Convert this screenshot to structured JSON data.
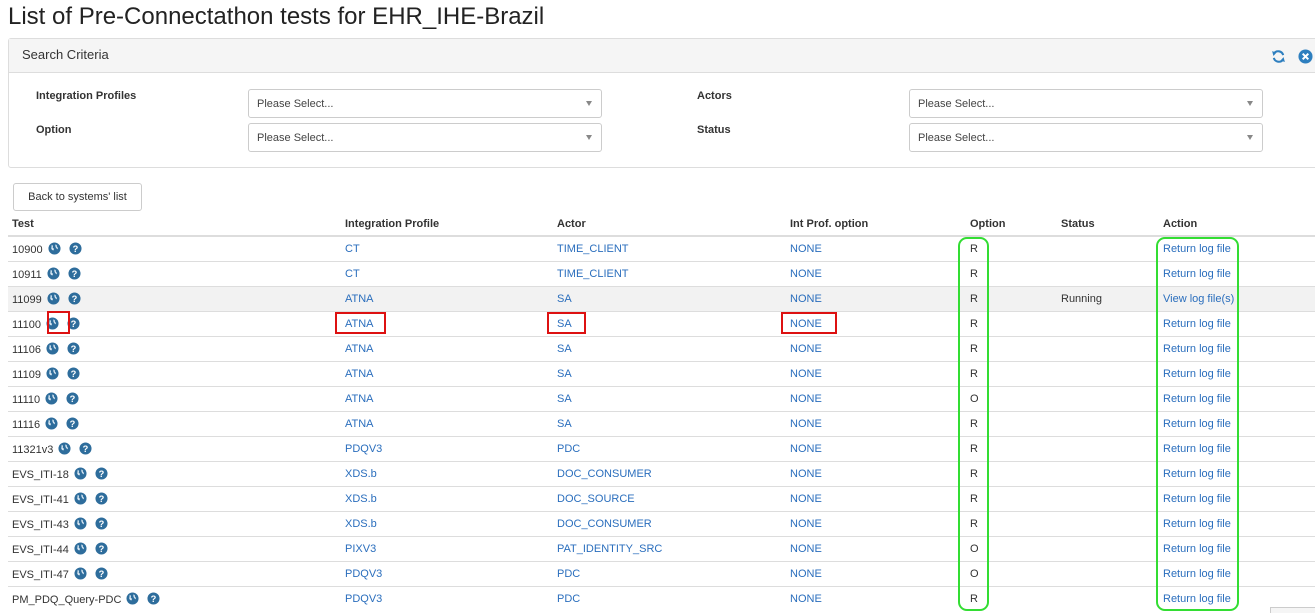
{
  "page": {
    "title": "List of Pre-Connectathon tests for EHR_IHE-Brazil"
  },
  "search": {
    "title": "Search Criteria",
    "integration_profiles": {
      "label": "Integration Profiles",
      "placeholder": "Please Select..."
    },
    "actors": {
      "label": "Actors",
      "placeholder": "Please Select..."
    },
    "option": {
      "label": "Option",
      "placeholder": "Please Select..."
    },
    "status": {
      "label": "Status",
      "placeholder": "Please Select..."
    }
  },
  "back_button": "Back to systems' list",
  "table": {
    "headers": {
      "test": "Test",
      "integration_profile": "Integration Profile",
      "actor": "Actor",
      "int_prof_option": "Int Prof. option",
      "option": "Option",
      "status": "Status",
      "action": "Action"
    },
    "rows": [
      {
        "test": "10900",
        "profile": "CT",
        "actor": "TIME_CLIENT",
        "int_option": "NONE",
        "option": "R",
        "status": "",
        "action": "Return log file"
      },
      {
        "test": "10911",
        "profile": "CT",
        "actor": "TIME_CLIENT",
        "int_option": "NONE",
        "option": "R",
        "status": "",
        "action": "Return log file"
      },
      {
        "test": "11099",
        "profile": "ATNA",
        "actor": "SA",
        "int_option": "NONE",
        "option": "R",
        "status": "Running",
        "action": "View log file(s)"
      },
      {
        "test": "11100",
        "profile": "ATNA",
        "actor": "SA",
        "int_option": "NONE",
        "option": "R",
        "status": "",
        "action": "Return log file"
      },
      {
        "test": "11106",
        "profile": "ATNA",
        "actor": "SA",
        "int_option": "NONE",
        "option": "R",
        "status": "",
        "action": "Return log file"
      },
      {
        "test": "11109",
        "profile": "ATNA",
        "actor": "SA",
        "int_option": "NONE",
        "option": "R",
        "status": "",
        "action": "Return log file"
      },
      {
        "test": "11110",
        "profile": "ATNA",
        "actor": "SA",
        "int_option": "NONE",
        "option": "O",
        "status": "",
        "action": "Return log file"
      },
      {
        "test": "11116",
        "profile": "ATNA",
        "actor": "SA",
        "int_option": "NONE",
        "option": "R",
        "status": "",
        "action": "Return log file"
      },
      {
        "test": "11321v3",
        "profile": "PDQV3",
        "actor": "PDC",
        "int_option": "NONE",
        "option": "R",
        "status": "",
        "action": "Return log file"
      },
      {
        "test": "EVS_ITI-18",
        "profile": "XDS.b",
        "actor": "DOC_CONSUMER",
        "int_option": "NONE",
        "option": "R",
        "status": "",
        "action": "Return log file"
      },
      {
        "test": "EVS_ITI-41",
        "profile": "XDS.b",
        "actor": "DOC_SOURCE",
        "int_option": "NONE",
        "option": "R",
        "status": "",
        "action": "Return log file"
      },
      {
        "test": "EVS_ITI-43",
        "profile": "XDS.b",
        "actor": "DOC_CONSUMER",
        "int_option": "NONE",
        "option": "R",
        "status": "",
        "action": "Return log file"
      },
      {
        "test": "EVS_ITI-44",
        "profile": "PIXV3",
        "actor": "PAT_IDENTITY_SRC",
        "int_option": "NONE",
        "option": "O",
        "status": "",
        "action": "Return log file"
      },
      {
        "test": "EVS_ITI-47",
        "profile": "PDQV3",
        "actor": "PDC",
        "int_option": "NONE",
        "option": "O",
        "status": "",
        "action": "Return log file"
      },
      {
        "test": "PM_PDQ_Query-PDC",
        "profile": "PDQV3",
        "actor": "PDC",
        "int_option": "NONE",
        "option": "R",
        "status": "",
        "action": "Return log file"
      }
    ]
  },
  "icons": {
    "globe": "globe-icon",
    "help": "help-icon",
    "refresh": "refresh-icon",
    "close": "close-icon"
  },
  "colors": {
    "link": "#2a6ebd",
    "icon": "#2e6d9c",
    "highlight_red": "#dd1111",
    "highlight_green": "#33dd33"
  }
}
